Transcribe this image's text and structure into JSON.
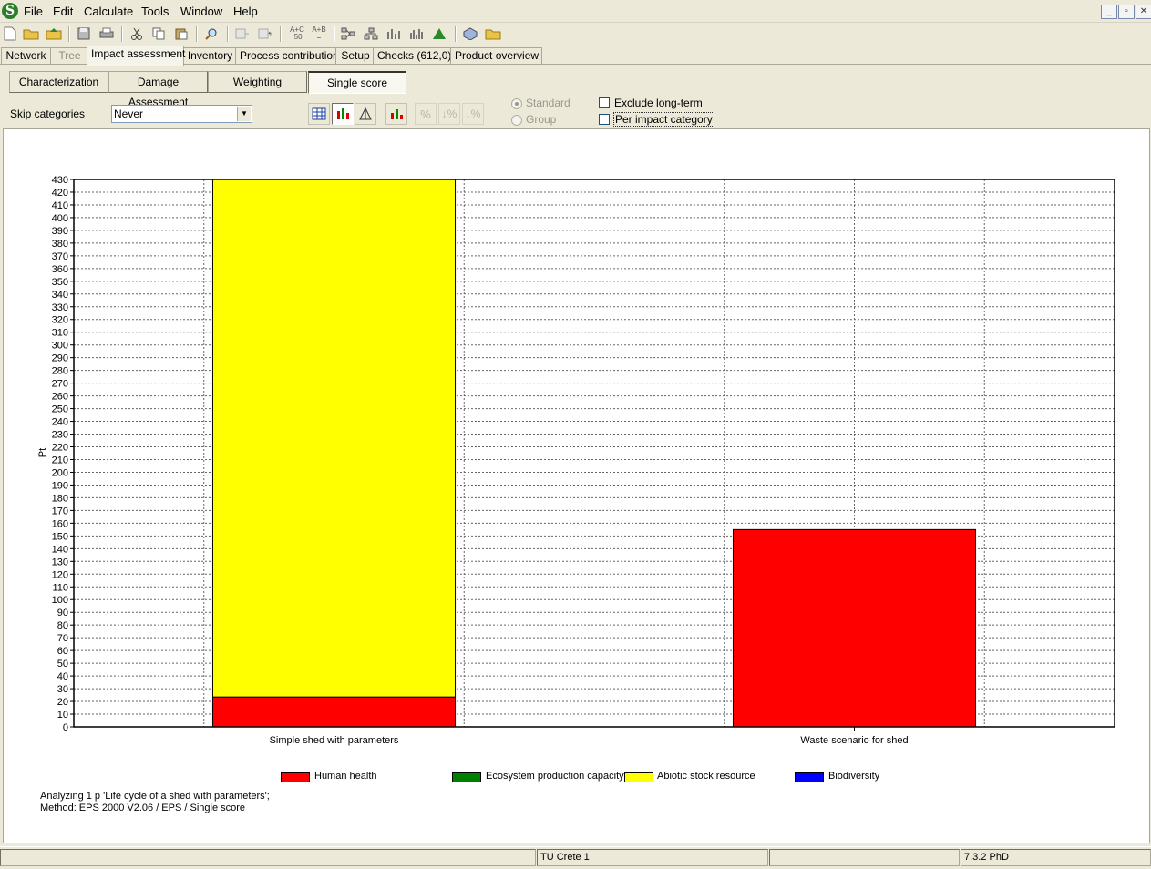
{
  "app": {
    "menu": [
      "File",
      "Edit",
      "Calculate",
      "Tools",
      "Window",
      "Help"
    ],
    "window_controls": [
      "minimize",
      "restore",
      "close"
    ]
  },
  "toolbar": {
    "icons": [
      "new-file-icon",
      "open-folder-icon",
      "export-icon",
      "save-icon",
      "print-icon",
      "cut-icon",
      "copy-icon",
      "paste-icon",
      "search-icon",
      "compare-icon",
      "compare-left-icon",
      "network-icon",
      "tree-icon",
      "bar-chart-icon",
      "column-chart-icon",
      "distribution-icon",
      "process-icon",
      "open-project-icon"
    ],
    "compare_labels": [
      "A+C\n.50",
      "A+B\n="
    ]
  },
  "tabs": [
    {
      "label": "Network",
      "state": "normal"
    },
    {
      "label": "Tree",
      "state": "disabled"
    },
    {
      "label": "Impact assessment",
      "state": "active"
    },
    {
      "label": "Inventory",
      "state": "normal"
    },
    {
      "label": "Process contribution",
      "state": "normal"
    },
    {
      "label": "Setup",
      "state": "normal"
    },
    {
      "label": "Checks (612,0)",
      "state": "normal"
    },
    {
      "label": "Product overview",
      "state": "normal"
    }
  ],
  "subtabs": [
    {
      "label": "Characterization",
      "active": false
    },
    {
      "label": "Damage Assessment",
      "active": false
    },
    {
      "label": "Weighting",
      "active": false
    },
    {
      "label": "Single score",
      "active": true
    }
  ],
  "options": {
    "skip_label": "Skip categories",
    "skip_value": "Never",
    "radio_standard": "Standard",
    "radio_group": "Group",
    "exclude_long_term": "Exclude long-term",
    "per_impact_category": "Per impact category"
  },
  "colors": {
    "human_health": "#ff0000",
    "ecosystem": "#008000",
    "abiotic": "#ffff00",
    "biodiversity": "#0000ff"
  },
  "chart_data": {
    "type": "bar",
    "stacked": true,
    "ylabel": "Pt",
    "ylim": [
      0,
      430
    ],
    "ytick_step": 10,
    "grid": true,
    "categories": [
      "Simple shed with parameters",
      "Waste scenario for shed"
    ],
    "series": [
      {
        "name": "Human health",
        "color": "#ff0000",
        "values": [
          23.5,
          155
        ]
      },
      {
        "name": "Ecosystem production capacity",
        "color": "#008000",
        "values": [
          0,
          0
        ]
      },
      {
        "name": "Abiotic stock resource",
        "color": "#ffff00",
        "values": [
          406.5,
          0
        ]
      },
      {
        "name": "Biodiversity",
        "color": "#0000ff",
        "values": [
          0,
          0
        ]
      }
    ],
    "legend_position": "bottom",
    "footnote_1": "Analyzing 1 p 'Life cycle of a shed with parameters';",
    "footnote_2": "Method: EPS 2000 V2.06 / EPS / Single score"
  },
  "status": {
    "cell1": "",
    "cell2": "TU Crete 1",
    "cell3": "",
    "cell4": "7.3.2 PhD"
  }
}
